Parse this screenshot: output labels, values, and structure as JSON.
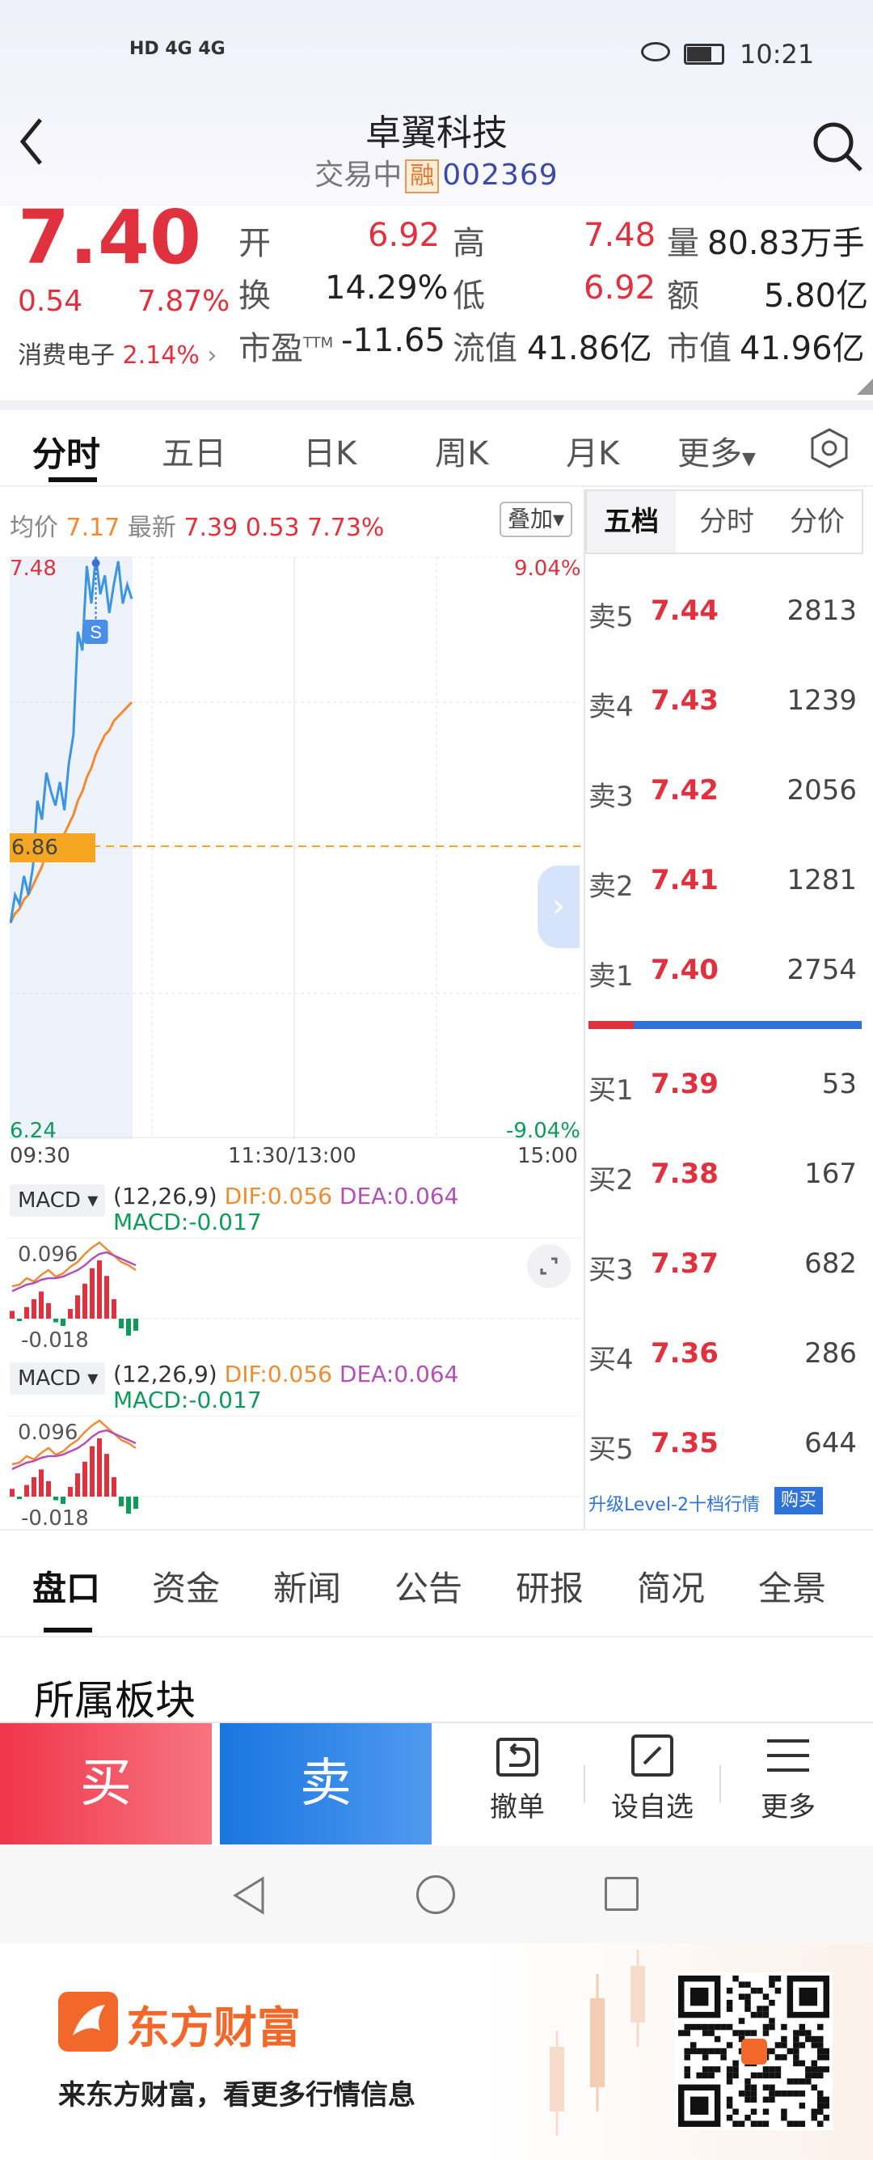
{
  "status_bar": {
    "network": "HD 4G 4G",
    "time": "10:21"
  },
  "header": {
    "title": "卓翼科技",
    "status": "交易中",
    "margin_tag": "融",
    "code": "002369"
  },
  "quote": {
    "price": "7.40",
    "change": "0.54",
    "change_pct": "7.87%",
    "sector_name": "消费电子",
    "sector_pct": "2.14%",
    "open_label": "开",
    "open": "6.92",
    "high_label": "高",
    "high": "7.48",
    "vol_label": "量",
    "vol": "80.83万手",
    "turnover_label": "换",
    "turnover": "14.29%",
    "low_label": "低",
    "low": "6.92",
    "amount_label": "额",
    "amount": "5.80亿",
    "pe_label": "市盈",
    "pe_sup": "TTM",
    "pe": "-11.65",
    "float_label": "流值",
    "float_cap": "41.86亿",
    "cap_label": "市值",
    "market_cap": "41.96亿"
  },
  "tabs": [
    "分时",
    "五日",
    "日K",
    "周K",
    "月K",
    "更多"
  ],
  "chart_legend": {
    "avg_label": "均价",
    "avg": "7.17",
    "latest_label": "最新",
    "latest": "7.39",
    "chg": "0.53",
    "chg_pct": "7.73%",
    "overlay_btn": "叠加"
  },
  "chart_axis": {
    "top_price": "7.48",
    "top_pct": "9.04%",
    "prev_close": "6.86",
    "bottom_price": "6.24",
    "bottom_pct": "-9.04%",
    "t_start": "09:30",
    "t_mid": "11:30/13:00",
    "t_end": "15:00"
  },
  "chart_data": {
    "type": "line",
    "series": [
      {
        "values": [
          6.7,
          6.76,
          6.74,
          6.8,
          6.76,
          6.82,
          6.96,
          6.92,
          7.02,
          6.98,
          6.95,
          7.0,
          6.94,
          7.04,
          7.1,
          7.32,
          7.28,
          7.46,
          7.38,
          7.48,
          7.4,
          7.44,
          7.36,
          7.42,
          7.47,
          7.38,
          7.42,
          7.39
        ]
      },
      {
        "values": [
          6.7,
          6.72,
          6.73,
          6.75,
          6.76,
          6.78,
          6.8,
          6.82,
          6.85,
          6.86,
          6.87,
          6.88,
          6.89,
          6.91,
          6.93,
          6.96,
          6.98,
          7.01,
          7.03,
          7.06,
          7.08,
          7.1,
          7.11,
          7.13,
          7.14,
          7.15,
          7.16,
          7.17
        ]
      }
    ],
    "ylim": [
      6.24,
      7.48
    ],
    "marker": "S"
  },
  "macd": {
    "btn": "MACD",
    "params": "(12,26,9)",
    "dif": "DIF:0.056",
    "dea": "DEA:0.064",
    "macd": "MACD:-0.017",
    "top": "0.096",
    "bottom": "-0.018"
  },
  "order_book": {
    "tabs": [
      "五档",
      "分时",
      "分价"
    ],
    "asks": [
      {
        "label": "卖5",
        "price": "7.44",
        "vol": "2813"
      },
      {
        "label": "卖4",
        "price": "7.43",
        "vol": "1239"
      },
      {
        "label": "卖3",
        "price": "7.42",
        "vol": "2056"
      },
      {
        "label": "卖2",
        "price": "7.41",
        "vol": "1281"
      },
      {
        "label": "卖1",
        "price": "7.40",
        "vol": "2754"
      }
    ],
    "bids": [
      {
        "label": "买1",
        "price": "7.39",
        "vol": "53"
      },
      {
        "label": "买2",
        "price": "7.38",
        "vol": "167"
      },
      {
        "label": "买3",
        "price": "7.37",
        "vol": "682"
      },
      {
        "label": "买4",
        "price": "7.36",
        "vol": "286"
      },
      {
        "label": "买5",
        "price": "7.35",
        "vol": "644"
      }
    ],
    "upgrade": "升级Level-2十档行情",
    "buy_btn": "购买"
  },
  "bottom_tabs": [
    "盘口",
    "资金",
    "新闻",
    "公告",
    "研报",
    "简况",
    "全景"
  ],
  "section_title": "所属板块",
  "actions": {
    "buy": "买",
    "sell": "卖",
    "cancel": "撤单",
    "watch": "设自选",
    "more": "更多"
  },
  "footer": {
    "brand": "东方财富",
    "slogan": "来东方财富，看更多行情信息"
  },
  "colors": {
    "up": "#e0313f",
    "down": "#0e9b5a",
    "accent": "#2f72d8",
    "avg_line": "#ef8b32"
  }
}
